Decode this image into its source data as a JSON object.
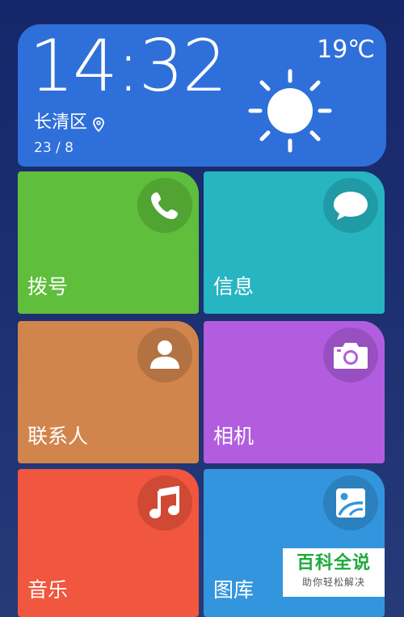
{
  "weather": {
    "time": "14:32",
    "temperature": "19℃",
    "location": "长清区",
    "date": "23 / 8",
    "icon": "sun-icon",
    "location_icon": "map-pin-icon"
  },
  "tiles": [
    {
      "label": "拨号",
      "icon": "phone-icon",
      "color": "#5fbe3b"
    },
    {
      "label": "信息",
      "icon": "message-bubble-icon",
      "color": "#26b5c1"
    },
    {
      "label": "联系人",
      "icon": "contact-person-icon",
      "color": "#d1854c"
    },
    {
      "label": "相机",
      "icon": "camera-icon",
      "color": "#b25ddf"
    },
    {
      "label": "音乐",
      "icon": "music-note-icon",
      "color": "#f1563e"
    },
    {
      "label": "图库",
      "icon": "gallery-image-icon",
      "color": "#3395de"
    }
  ],
  "watermark": {
    "title": "百科全说",
    "subtitle": "助你轻松解决"
  },
  "colors": {
    "weather_card": "#2f6fd9",
    "background": "#1c2f70"
  }
}
